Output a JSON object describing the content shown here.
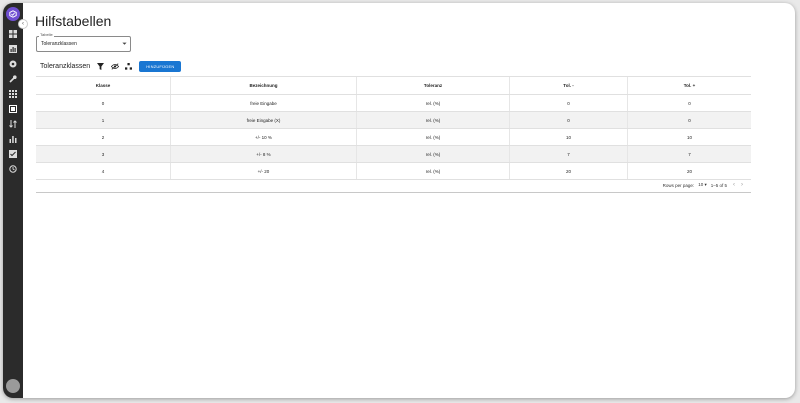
{
  "sidebar": {
    "icons": [
      "dashboard-icon",
      "chart-icon",
      "settings-gear-icon",
      "wrench-icon",
      "grid-icon",
      "table-icon",
      "sort-icon",
      "bar-chart-icon",
      "document-icon",
      "history-icon"
    ],
    "avatar_text": "",
    "collapse_glyph": "‹"
  },
  "page": {
    "title": "Hilfstabellen"
  },
  "select": {
    "label": "Tabelle",
    "value": "Toleranzklassen"
  },
  "toolbar": {
    "title": "Toleranzklassen",
    "add_label": "HINZUFÜGEN"
  },
  "table": {
    "headers": [
      "Klasse",
      "Bezeichnung",
      "Toleranz",
      "Tol. -",
      "Tol. +"
    ],
    "rows": [
      [
        "0",
        "freie Eingabe",
        "rel. (%)",
        "0",
        "0"
      ],
      [
        "1",
        "freie Eingabe (X)",
        "rel. (%)",
        "0",
        "0"
      ],
      [
        "2",
        "+/- 10 %",
        "rel. (%)",
        "10",
        "10"
      ],
      [
        "3",
        "+/- 8 %",
        "rel. (%)",
        "7",
        "7"
      ],
      [
        "4",
        "+/- 20",
        "rel. (%)",
        "20",
        "20"
      ]
    ]
  },
  "pagination": {
    "rows_label": "Rows per page:",
    "rows_value": "10",
    "range": "1–5 of 5"
  }
}
